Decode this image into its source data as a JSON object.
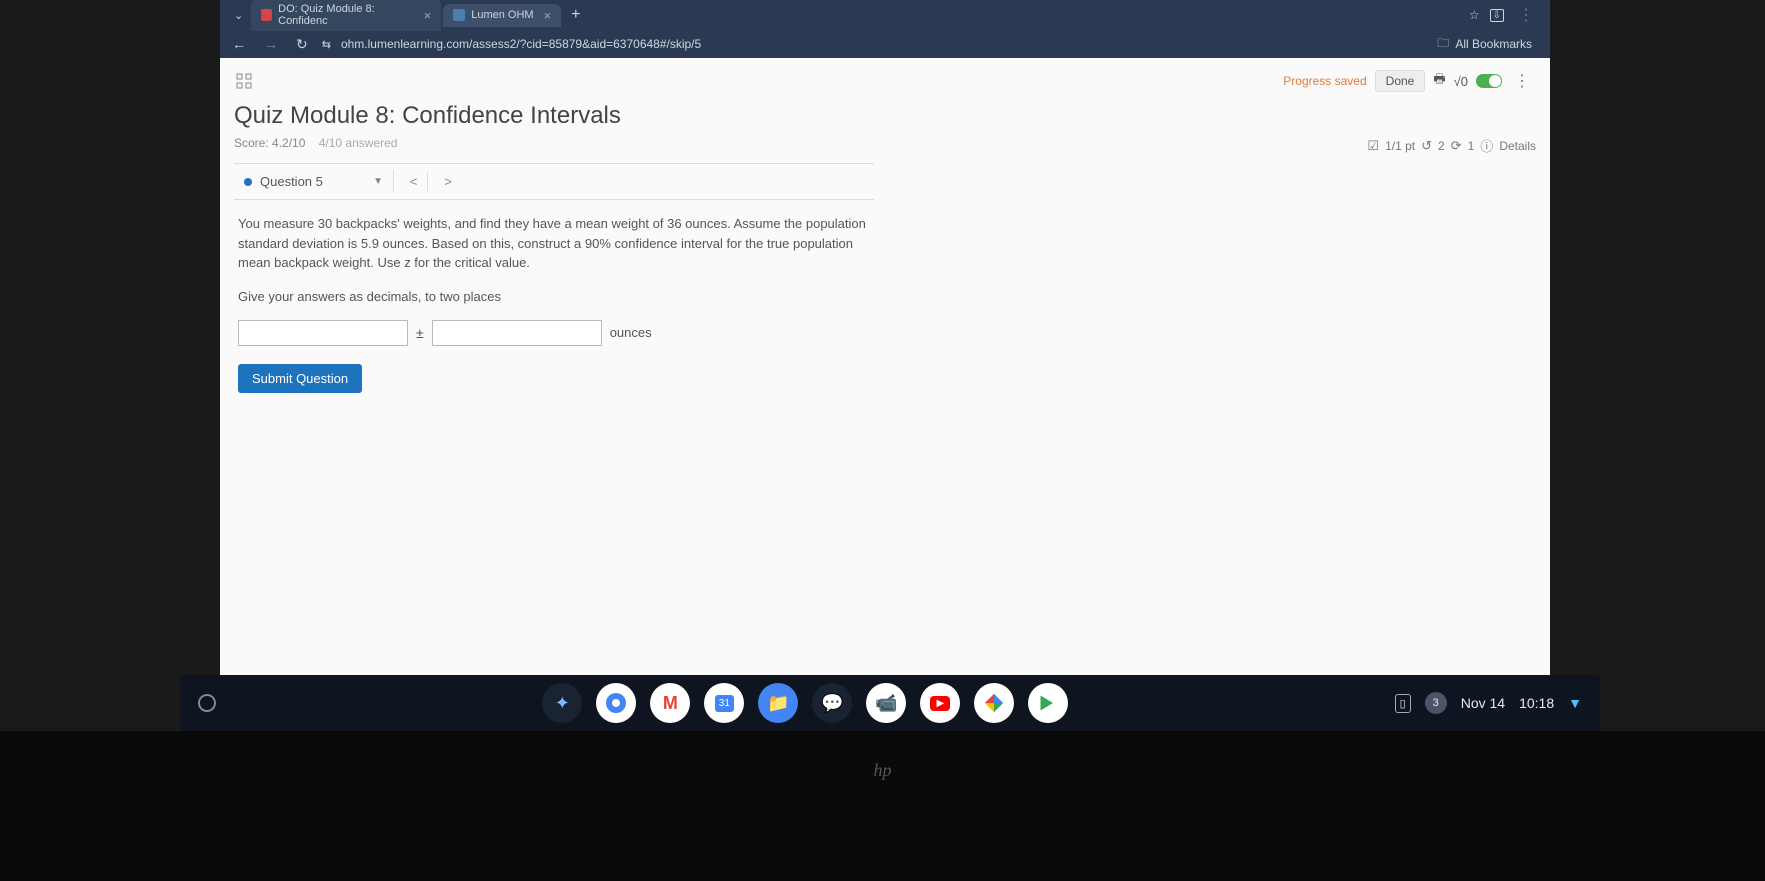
{
  "browser": {
    "tabs": [
      {
        "label": "DO: Quiz Module 8: Confidenc",
        "icon_color": "#d64545"
      },
      {
        "label": "Lumen OHM",
        "icon_color": "#4a7fb5"
      }
    ],
    "url": "ohm.lumenlearning.com/assess2/?cid=85879&aid=6370648#/skip/5",
    "all_bookmarks": "All Bookmarks"
  },
  "header": {
    "progress_saved": "Progress saved",
    "done": "Done",
    "math_symbol": "√0"
  },
  "page": {
    "title": "Quiz Module 8: Confidence Intervals",
    "score_label": "Score: 4.2/10",
    "answered_label": "4/10 answered"
  },
  "details": {
    "points": "1/1 pt",
    "retry_count": "2",
    "attempts": "1",
    "details_label": "Details"
  },
  "question": {
    "selector_label": "Question 5",
    "text1": "You measure 30 backpacks' weights, and find they have a mean weight of 36 ounces. Assume the population standard deviation is 5.9 ounces. Based on this, construct a 90% confidence interval for the true population mean backpack weight. Use z for the critical value.",
    "text2": "Give your answers as decimals, to two places",
    "plus_minus": "±",
    "unit": "ounces",
    "submit": "Submit Question"
  },
  "taskbar": {
    "badge": "3",
    "date": "Nov 14",
    "time": "10:18"
  }
}
